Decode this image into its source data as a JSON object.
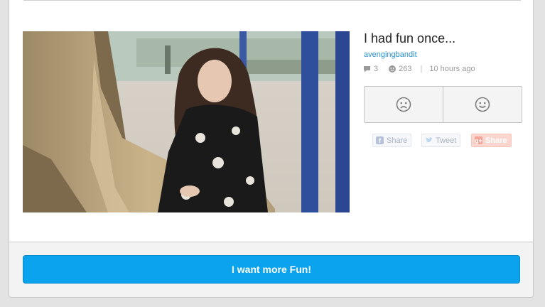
{
  "post": {
    "title": "I had fun once...",
    "author": "avengingbandit",
    "comments": "3",
    "views": "263",
    "separator": "|",
    "time": "10 hours ago"
  },
  "vote": {
    "dislike_icon": "frown-face-icon",
    "like_icon": "smile-face-icon"
  },
  "share": {
    "facebook_label": "Share",
    "twitter_label": "Tweet",
    "googleplus_label": "Share"
  },
  "footer": {
    "more_label": "I want more Fun!"
  },
  "colors": {
    "accent": "#0ba3ee",
    "link": "#2a8fd0",
    "meta_text": "#9a9a9a"
  }
}
